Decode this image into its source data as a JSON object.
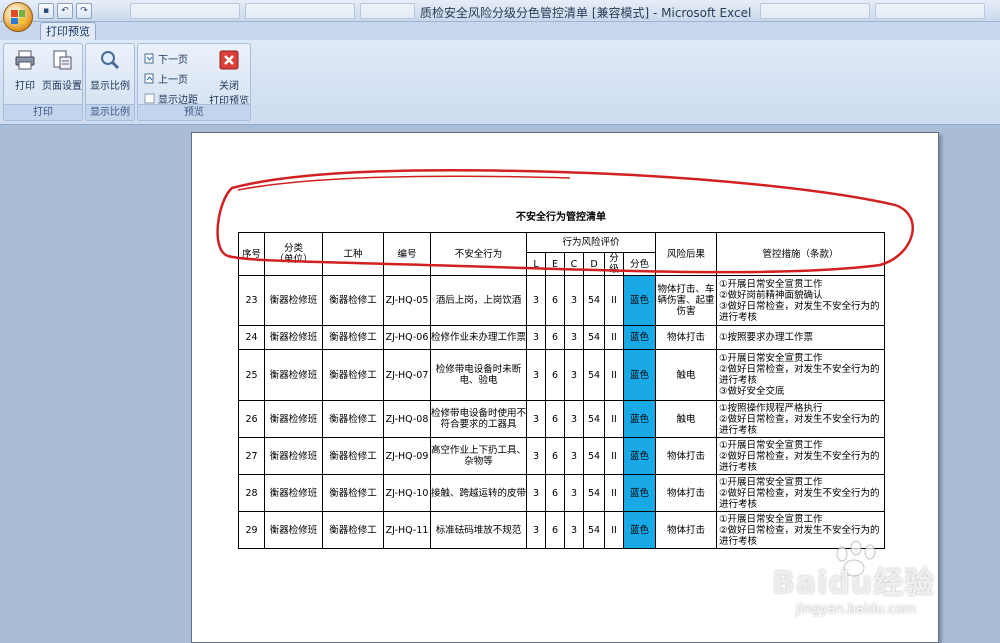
{
  "window": {
    "title": "质检安全风险分级分色管控清单 [兼容模式] - Microsoft Excel"
  },
  "ribbon": {
    "tab": "打印预览",
    "groups": {
      "print": {
        "label": "打印",
        "print_btn": "打印",
        "page_setup_btn": "页面设置"
      },
      "zoom": {
        "label": "显示比例",
        "zoom_btn": "显示比例"
      },
      "preview": {
        "label": "预览",
        "next_page": "下一页",
        "prev_page": "上一页",
        "show_margins": "显示边距",
        "close_btn_line1": "关闭",
        "close_btn_line2": "打印预览"
      }
    }
  },
  "document": {
    "title": "不安全行为管控清单",
    "headers": {
      "seq": "序号",
      "category_line1": "分类",
      "category_line2": "（单位）",
      "job": "工种",
      "code": "编号",
      "behavior": "不安全行为",
      "risk_eval": "行为风险评价",
      "L": "L",
      "E": "E",
      "C": "C",
      "D": "D",
      "grade": "分级",
      "color": "分色",
      "consequence": "风险后果",
      "measures": "管控措施（条款）"
    },
    "rows": [
      {
        "seq": "23",
        "category": "衡器检修班",
        "job": "衡器检修工",
        "code": "ZJ-HQ-05",
        "behavior": "酒后上岗，上岗饮酒",
        "L": "3",
        "E": "6",
        "C": "3",
        "D": "54",
        "grade": "II",
        "color": "蓝色",
        "consequence": "物体打击、车辆伤害、起重伤害",
        "measures": "①开展日常安全宣贯工作\n②做好岗前精神面貌确认\n③做好日常检查，对发生不安全行为的进行考核"
      },
      {
        "seq": "24",
        "category": "衡器检修班",
        "job": "衡器检修工",
        "code": "ZJ-HQ-06",
        "behavior": "检修作业未办理工作票",
        "L": "3",
        "E": "6",
        "C": "3",
        "D": "54",
        "grade": "II",
        "color": "蓝色",
        "consequence": "物体打击",
        "measures": "①按照要求办理工作票"
      },
      {
        "seq": "25",
        "category": "衡器检修班",
        "job": "衡器检修工",
        "code": "ZJ-HQ-07",
        "behavior": "检修带电设备时未断电、验电",
        "L": "3",
        "E": "6",
        "C": "3",
        "D": "54",
        "grade": "II",
        "color": "蓝色",
        "consequence": "触电",
        "measures": "①开展日常安全宣贯工作\n②做好日常检查，对发生不安全行为的进行考核\n③做好安全交底"
      },
      {
        "seq": "26",
        "category": "衡器检修班",
        "job": "衡器检修工",
        "code": "ZJ-HQ-08",
        "behavior": "检修带电设备时使用不符合要求的工器具",
        "L": "3",
        "E": "6",
        "C": "3",
        "D": "54",
        "grade": "II",
        "color": "蓝色",
        "consequence": "触电",
        "measures": "①按照操作规程严格执行\n②做好日常检查，对发生不安全行为的进行考核"
      },
      {
        "seq": "27",
        "category": "衡器检修班",
        "job": "衡器检修工",
        "code": "ZJ-HQ-09",
        "behavior": "高空作业上下扔工具、杂物等",
        "L": "3",
        "E": "6",
        "C": "3",
        "D": "54",
        "grade": "II",
        "color": "蓝色",
        "consequence": "物体打击",
        "measures": "①开展日常安全宣贯工作\n②做好日常检查，对发生不安全行为的进行考核"
      },
      {
        "seq": "28",
        "category": "衡器检修班",
        "job": "衡器检修工",
        "code": "ZJ-HQ-10",
        "behavior": "接触、跨越运转的皮带",
        "L": "3",
        "E": "6",
        "C": "3",
        "D": "54",
        "grade": "II",
        "color": "蓝色",
        "consequence": "物体打击",
        "measures": "①开展日常安全宣贯工作\n②做好日常检查，对发生不安全行为的进行考核"
      },
      {
        "seq": "29",
        "category": "衡器检修班",
        "job": "衡器检修工",
        "code": "ZJ-HQ-11",
        "behavior": "标准砝码堆放不规范",
        "L": "3",
        "E": "6",
        "C": "3",
        "D": "54",
        "grade": "II",
        "color": "蓝色",
        "consequence": "物体打击",
        "measures": "①开展日常安全宣贯工作\n②做好日常检查，对发生不安全行为的进行考核"
      }
    ]
  },
  "watermark": {
    "brand": "Baidu经验",
    "url": "jingyan.baidu.com"
  },
  "colors": {
    "blue_cell": "#19a9e6",
    "annotation": "#d22020"
  }
}
